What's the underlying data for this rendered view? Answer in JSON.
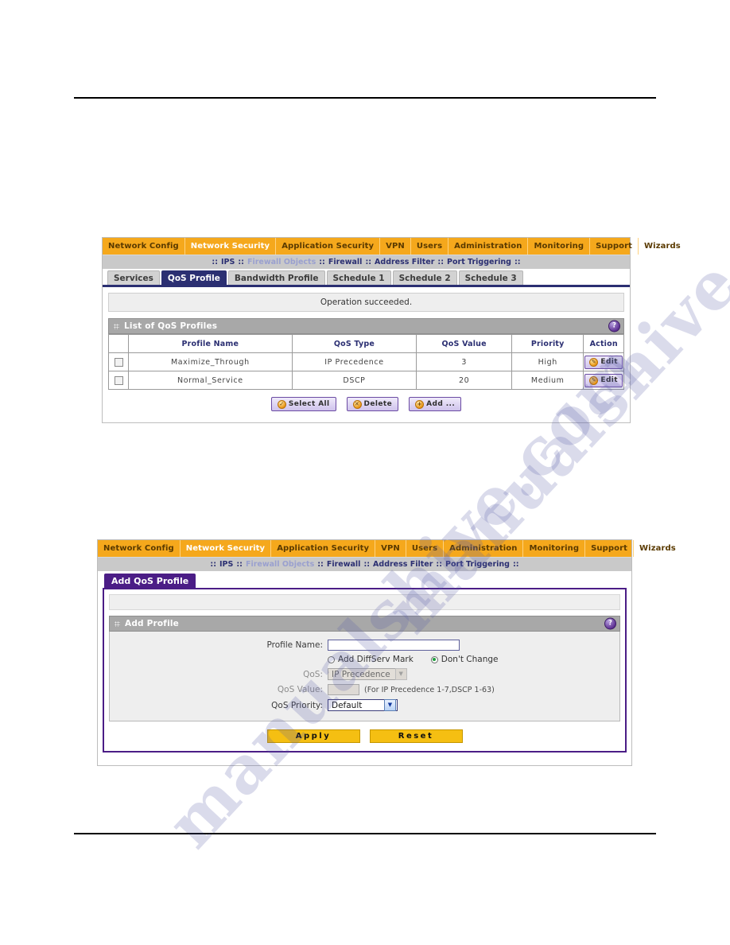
{
  "watermark": {
    "line1": "manualshive.com",
    "line2": "manualshive.com"
  },
  "shot1": {
    "menu": [
      {
        "label": "Network Config",
        "active": false
      },
      {
        "label": "Network Security",
        "active": true
      },
      {
        "label": "Application Security",
        "active": false
      },
      {
        "label": "VPN",
        "active": false
      },
      {
        "label": "Users",
        "active": false
      },
      {
        "label": "Administration",
        "active": false
      },
      {
        "label": "Monitoring",
        "active": false
      },
      {
        "label": "Support",
        "active": false
      },
      {
        "label": "Wizards",
        "active": false
      }
    ],
    "breadcrumb": [
      "IPS",
      "Firewall Objects",
      "Firewall",
      "Address Filter",
      "Port Triggering"
    ],
    "breadcrumb_sep": "::",
    "tabs": [
      {
        "label": "Services",
        "active": false
      },
      {
        "label": "QoS Profile",
        "active": true
      },
      {
        "label": "Bandwidth Profile",
        "active": false
      },
      {
        "label": "Schedule 1",
        "active": false
      },
      {
        "label": "Schedule 2",
        "active": false
      },
      {
        "label": "Schedule 3",
        "active": false
      }
    ],
    "notice": "Operation succeeded.",
    "section_title": "List of QoS Profiles",
    "help_glyph": "?",
    "table": {
      "headers": [
        "",
        "Profile Name",
        "QoS Type",
        "QoS Value",
        "Priority",
        "Action"
      ],
      "rows": [
        {
          "name": "Maximize_Through",
          "type": "IP Precedence",
          "value": "3",
          "priority": "High",
          "action": "Edit"
        },
        {
          "name": "Normal_Service",
          "type": "DSCP",
          "value": "20",
          "priority": "Medium",
          "action": "Edit"
        }
      ]
    },
    "buttons": [
      {
        "label": "Select All",
        "glyph": "✓"
      },
      {
        "label": "Delete",
        "glyph": "✕"
      },
      {
        "label": "Add ...",
        "glyph": "+"
      }
    ]
  },
  "shot2": {
    "menu": [
      {
        "label": "Network Config",
        "active": false
      },
      {
        "label": "Network Security",
        "active": true
      },
      {
        "label": "Application Security",
        "active": false
      },
      {
        "label": "VPN",
        "active": false
      },
      {
        "label": "Users",
        "active": false
      },
      {
        "label": "Administration",
        "active": false
      },
      {
        "label": "Monitoring",
        "active": false
      },
      {
        "label": "Support",
        "active": false
      },
      {
        "label": "Wizards",
        "active": false
      }
    ],
    "breadcrumb": [
      "IPS",
      "Firewall Objects",
      "Firewall",
      "Address Filter",
      "Port Triggering"
    ],
    "breadcrumb_sep": "::",
    "page_tab": "Add QoS Profile",
    "section_title": "Add Profile",
    "help_glyph": "?",
    "form": {
      "profile_name_label": "Profile Name:",
      "profile_name_value": "",
      "radio_add_label": "Add DiffServ Mark",
      "radio_dont_label": "Don't Change",
      "radio_selected": "dont_change",
      "qos_label": "QoS:",
      "qos_value_selected": "IP Precedence",
      "qos_value_label": "QoS Value:",
      "qos_value_input": "",
      "qos_value_hint": "(For IP Precedence 1-7,DSCP 1-63)",
      "qos_priority_label": "QoS Priority:",
      "qos_priority_selected": "Default",
      "dropdown_arrow": "▼"
    },
    "apply_label": "Apply",
    "reset_label": "Reset"
  }
}
